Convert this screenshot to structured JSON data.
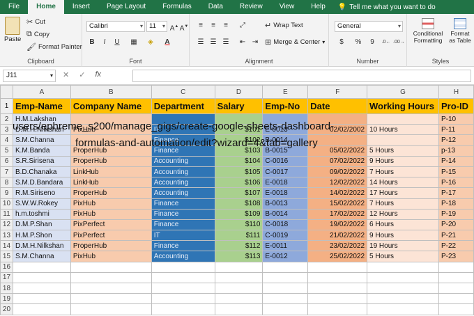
{
  "menu": {
    "tabs": [
      "File",
      "Home",
      "Insert",
      "Page Layout",
      "Formulas",
      "Data",
      "Review",
      "View",
      "Help"
    ],
    "active": "Home",
    "tell_me": "Tell me what you want to do"
  },
  "ribbon": {
    "clipboard": {
      "label": "Clipboard",
      "paste": "Paste",
      "cut": "Cut",
      "copy": "Copy",
      "format_painter": "Format Painter"
    },
    "font": {
      "label": "Font",
      "name": "Calibri",
      "size": "11",
      "bold": "B",
      "italic": "I",
      "underline": "U"
    },
    "alignment": {
      "label": "Alignment",
      "wrap": "Wrap Text",
      "merge": "Merge & Center"
    },
    "number": {
      "label": "Number",
      "format": "General",
      "currency": "$",
      "percent": "%",
      "comma": "9"
    },
    "styles": {
      "label": "Styles",
      "conditional": "Conditional Formatting",
      "format_as": "Format as Table"
    }
  },
  "formula_bar": {
    "name_box": "J11",
    "fx": "fx",
    "value": ""
  },
  "sheet": {
    "columns": [
      "A",
      "B",
      "C",
      "D",
      "E",
      "F",
      "G",
      "H"
    ],
    "headers": [
      "Emp-Name",
      "Company Name",
      "Department",
      "Salary",
      "Emp-No",
      "Date",
      "Working Hours",
      "Pro-ID"
    ],
    "rows": [
      [
        "H.M.Lakshan",
        "",
        "",
        "",
        "",
        "",
        "",
        "P-10"
      ],
      [
        "D.M.H.Nilkshan",
        "PixHub",
        "IT",
        "$101",
        "E-0013",
        "02/02/2002",
        "10 Hours",
        "P-11"
      ],
      [
        "S.M.Channa",
        "",
        "Finance",
        "$102",
        "B-0014",
        "",
        "",
        "P-12"
      ],
      [
        "K.M.Banda",
        "ProperHub",
        "Finance",
        "$103",
        "B-0015",
        "05/02/2022",
        "5 Hours",
        "p-13"
      ],
      [
        "S.R.Sirisena",
        "ProperHub",
        "Accounting",
        "$104",
        "C-0016",
        "07/02/2022",
        "9 Hours",
        "P-14"
      ],
      [
        "B.D.Chanaka",
        "LinkHub",
        "Accounting",
        "$105",
        "C-0017",
        "09/02/2022",
        "7 Hours",
        "P-15"
      ],
      [
        "S.M.D.Bandara",
        "LinkHub",
        "Accounting",
        "$106",
        "E-0018",
        "12/02/2022",
        "14 Hours",
        "P-16"
      ],
      [
        "R.M.Siriseno",
        "ProperHub",
        "Accounting",
        "$107",
        "E-0018",
        "14/02/2022",
        "17 Hours",
        "P-17"
      ],
      [
        "S.W.W.Rokey",
        "PixHub",
        "Finance",
        "$108",
        "B-0013",
        "15/02/2022",
        "7 Hours",
        "P-18"
      ],
      [
        "h.m.toshmi",
        "PixHub",
        "Finance",
        "$109",
        "B-0014",
        "17/02/2022",
        "12 Hours",
        "P-19"
      ],
      [
        "D.M.P.Shan",
        "PixPerfect",
        "Finance",
        "$110",
        "C-0018",
        "19/02/2022",
        "6 Hours",
        "P-20"
      ],
      [
        "H.M.P.Shon",
        "PixPerfect",
        "IT",
        "$111",
        "C-0019",
        "21/02/2022",
        "9 Hours",
        "P-21"
      ],
      [
        "D.M.H.Nilkshan",
        "ProperHub",
        "Finance",
        "$112",
        "E-0011",
        "23/02/2022",
        "19 Hours",
        "P-22"
      ],
      [
        "S.M.Channa",
        "PixHub",
        "Accounting",
        "$113",
        "E-0012",
        "25/02/2022",
        "5 Hours",
        "P-23"
      ]
    ],
    "empty_rows": [
      16,
      17,
      18,
      19,
      20
    ]
  },
  "overlay_text": [
    "users/ephreme_s200/manage_gigs/create-google-sheets-dashboard-",
    "formulas-and-automation/edit?wizard=4&tab=gallery"
  ],
  "colors": {
    "menu_bg": "#217346",
    "header_fill": "#ffc000",
    "col_a": "#d9e1f2",
    "col_b": "#f8cbad",
    "col_c": "#2f75b5",
    "col_d": "#a9d08e",
    "col_e": "#8ea9db",
    "col_f": "#f4b084",
    "col_g": "#fce4d6",
    "col_h": "#f8cbad"
  }
}
